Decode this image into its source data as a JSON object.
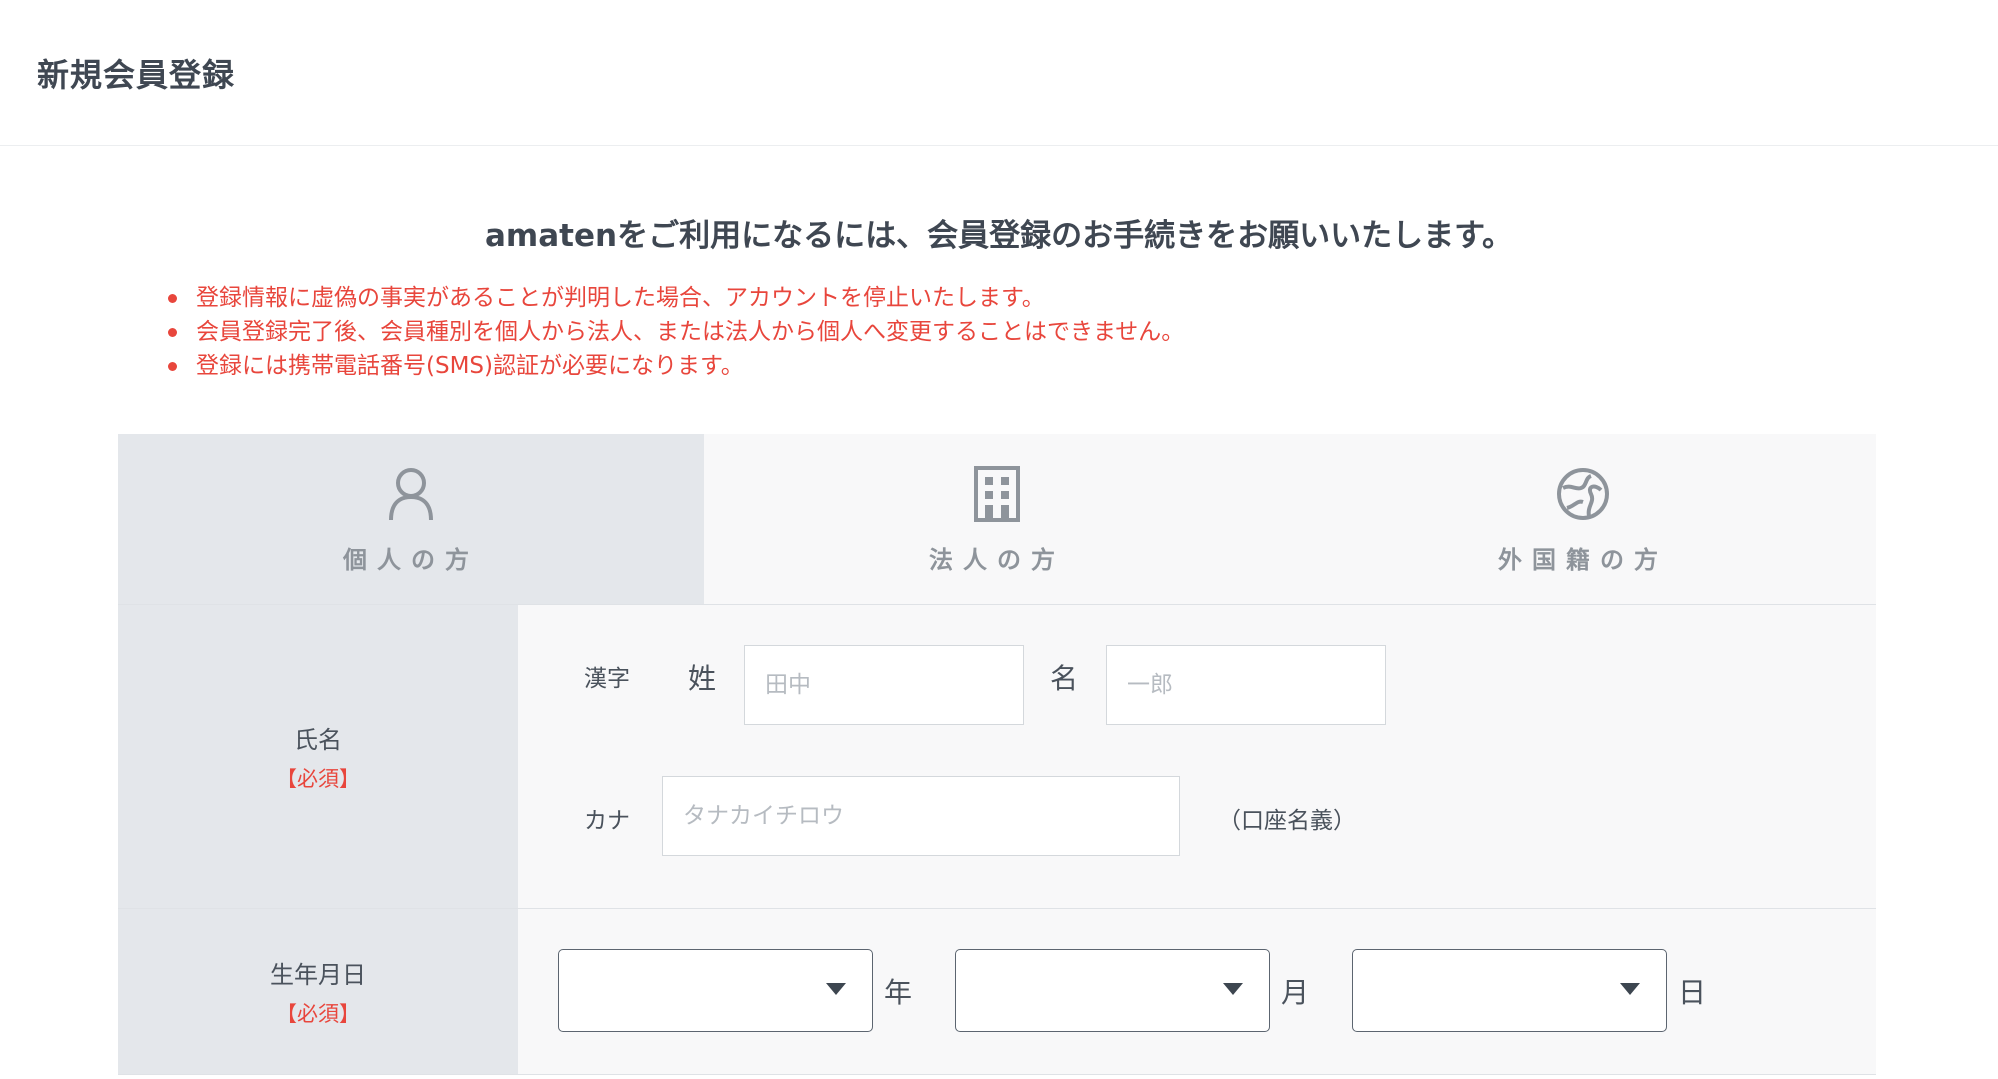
{
  "header": {
    "title": "新規会員登録"
  },
  "intro": {
    "heading": "amatenをご利用になるには、会員登録のお手続きをお願いいたします。",
    "notes": [
      "登録情報に虚偽の事実があることが判明した場合、アカウントを停止いたします。",
      "会員登録完了後、会員種別を個人から法人、または法人から個人へ変更することはできません。",
      "登録には携帯電話番号(SMS)認証が必要になります。"
    ]
  },
  "tabs": [
    {
      "label": "個人の方",
      "icon": "person-icon",
      "active": true
    },
    {
      "label": "法人の方",
      "icon": "building-icon",
      "active": false
    },
    {
      "label": "外国籍の方",
      "icon": "globe-icon",
      "active": false
    }
  ],
  "form": {
    "name": {
      "label": "氏名",
      "required": "【必須】",
      "kanji_label": "漢字",
      "sei_label": "姓",
      "sei_placeholder": "田中",
      "sei_value": "",
      "mei_label": "名",
      "mei_placeholder": "一郎",
      "mei_value": "",
      "kana_label": "カナ",
      "kana_placeholder": "タナカイチロウ",
      "kana_value": "",
      "kana_note": "（口座名義）"
    },
    "birthday": {
      "label": "生年月日",
      "required": "【必須】",
      "year_value": "",
      "year_suffix": "年",
      "month_value": "",
      "month_suffix": "月",
      "day_value": "",
      "day_suffix": "日"
    }
  },
  "colors": {
    "required_red": "#e8463c",
    "label_bg": "#e4e7eb",
    "field_bg": "#f8f8f9",
    "icon_gray": "#8e949b"
  }
}
